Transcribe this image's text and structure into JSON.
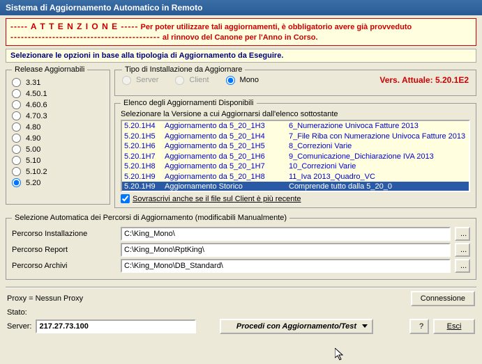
{
  "title": "Sistema di Aggiornamento Automatico in Remoto",
  "warn": {
    "head": "----- A T T E N Z I O N E -----",
    "text1": "Per poter utilizzare tali aggiornamenti, è obbligatorio avere già provveduto",
    "dashes": "-------------------------------------------",
    "text2": "al rinnovo del Canone per l'Anno in Corso."
  },
  "sel_label": "Selezionare le opzioni in base alla tipologia di Aggiornamento da Eseguire.",
  "releases": {
    "legend": "Release Aggiornabili",
    "items": [
      "3.31",
      "4.50.1",
      "4.60.6",
      "4.70.3",
      "4.80",
      "4.90",
      "5.00",
      "5.10",
      "5.10.2",
      "5.20"
    ],
    "selected": "5.20"
  },
  "tipo": {
    "legend": "Tipo di Installazione da Aggiornare",
    "server": "Server",
    "client": "Client",
    "mono": "Mono"
  },
  "vers": "Vers. Attuale:  5.20.1E2",
  "elenco": {
    "legend": "Elenco degli Aggiornamenti Disponibili",
    "sub": "Selezionare la Versione a cui Aggiornarsi dall'elenco sottostante",
    "rows": [
      {
        "c1": "5.20.1H4",
        "c2": "Aggiornamento da 5_20_1H3",
        "c3": "6_Numerazione Univoca Fatture 2013"
      },
      {
        "c1": "5.20.1H5",
        "c2": "Aggiornamento da 5_20_1H4",
        "c3": "7_File Riba con Numerazione Univoca Fatture 2013"
      },
      {
        "c1": "5.20.1H6",
        "c2": "Aggiornamento da 5_20_1H5",
        "c3": "8_Correzioni Varie"
      },
      {
        "c1": "5.20.1H7",
        "c2": "Aggiornamento da 5_20_1H6",
        "c3": "9_Comunicazione_Dichiarazione IVA 2013"
      },
      {
        "c1": "5.20.1H8",
        "c2": "Aggiornamento da 5_20_1H7",
        "c3": "10_Correzioni Varie"
      },
      {
        "c1": "5.20.1H9",
        "c2": "Aggiornamento da 5_20_1H8",
        "c3": "11_Iva 2013_Quadro_VC"
      },
      {
        "c1": "5.20.1H9",
        "c2": "Aggiornamento Storico",
        "c3": "Comprende tutto dalla 5_20_0",
        "sel": true
      }
    ],
    "chk": "Sovrascrivi anche se il file sul Client è più recente"
  },
  "paths": {
    "legend": "Selezione Automatica dei Percorsi di Aggiornamento (modificabili Manualmente)",
    "install_lbl": "Percorso Installazione",
    "install_val": "C:\\King_Mono\\",
    "report_lbl": "Percorso Report",
    "report_val": "C:\\King_Mono\\RptKing\\",
    "archivi_lbl": "Percorso Archivi",
    "archivi_val": "C:\\King_Mono\\DB_Standard\\",
    "browse": "..."
  },
  "bottom": {
    "proxy": "Proxy = Nessun Proxy",
    "conn": "Connessione",
    "stato": "Stato:",
    "server_lbl": "Server:",
    "server_val": "217.27.73.100",
    "procedi": "Procedi con Aggiornamento/Test",
    "help": "?",
    "esci": "Esci"
  }
}
